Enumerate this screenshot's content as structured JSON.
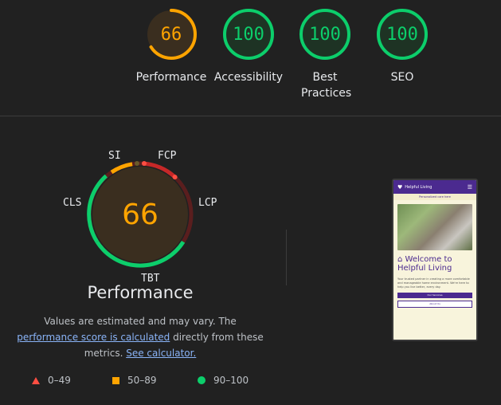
{
  "summary_gauges": [
    {
      "score": "66",
      "label": "Performance",
      "color": "#ffa400",
      "fraction": 0.66
    },
    {
      "score": "100",
      "label": "Accessibility",
      "color": "#0cce6b",
      "fraction": 1.0
    },
    {
      "score": "100",
      "label": "Best Practices",
      "color": "#0cce6b",
      "fraction": 1.0
    },
    {
      "score": "100",
      "label": "SEO",
      "color": "#0cce6b",
      "fraction": 1.0
    }
  ],
  "performance": {
    "score": "66",
    "title": "Performance",
    "metrics": {
      "si": "SI",
      "fcp": "FCP",
      "lcp": "LCP",
      "tbt": "TBT",
      "cls": "CLS"
    },
    "note": {
      "text1": "Values are estimated and may vary. The ",
      "link1": "performance score is calculated",
      "text2": " directly from these metrics. ",
      "link2": "See calculator."
    }
  },
  "legend": [
    {
      "range": "0–49",
      "shape": "triangle-icon",
      "color": "#ff4e42"
    },
    {
      "range": "50–89",
      "shape": "square-icon",
      "color": "#ffa400"
    },
    {
      "range": "90–100",
      "shape": "circle-icon",
      "color": "#0cce6b"
    }
  ],
  "screenshot": {
    "brand": "Helpful Living",
    "banner": "Personalized care here",
    "heading": "Welcome to Helpful Living",
    "body": "Your trusted partner in creating a more comfortable and manageable home environment. We're here to help you live better, every day.",
    "button1": "Our Services",
    "button2": "About Us"
  },
  "colors": {
    "background": "#212121",
    "good": "#0cce6b",
    "average": "#ffa400",
    "poor": "#ff4e42"
  }
}
